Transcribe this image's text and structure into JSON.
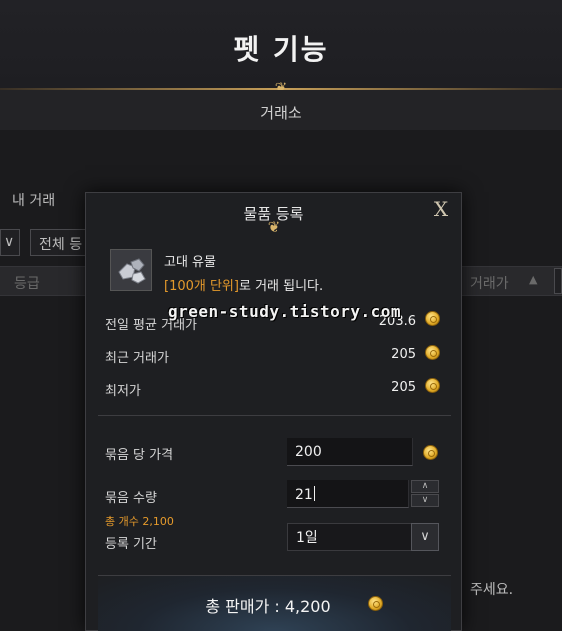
{
  "header": {
    "title": "펫 기능",
    "subtitle": "거래소"
  },
  "background": {
    "my_trade_tab": "내 거래",
    "dropdown_arrow": "∨",
    "filter_all": "전체 등",
    "col_grade": "등급",
    "col_price": "거래가",
    "sort_arrow": "▲",
    "hint_tail": "주세요."
  },
  "dialog": {
    "title": "물품 등록",
    "close_label": "X",
    "item_name": "고대 유물",
    "trade_unit": "[100개 단위]",
    "trade_note": "로 거래 됩니다.",
    "stats": [
      {
        "label": "전일 평균 거래가",
        "value": "203.6"
      },
      {
        "label": "최근 거래가",
        "value": "205"
      },
      {
        "label": "최저가",
        "value": "205"
      }
    ],
    "bundle_price_label": "묶음 당 가격",
    "bundle_price_value": "200",
    "bundle_qty_label": "묶음 수량",
    "bundle_qty_value": "21",
    "total_count": "총 개수 2,100",
    "period_label": "등록 기간",
    "period_value": "1일",
    "total_label": "총 판매가 : 4,200"
  },
  "watermark": "green-study.tistory.com",
  "icons": {
    "currency": "gold-coin-icon",
    "item": "ancient-relic-icon"
  },
  "colors": {
    "accent_orange": "#e59a2c",
    "gold": "#c9a15a",
    "coin": "#e0a925"
  }
}
